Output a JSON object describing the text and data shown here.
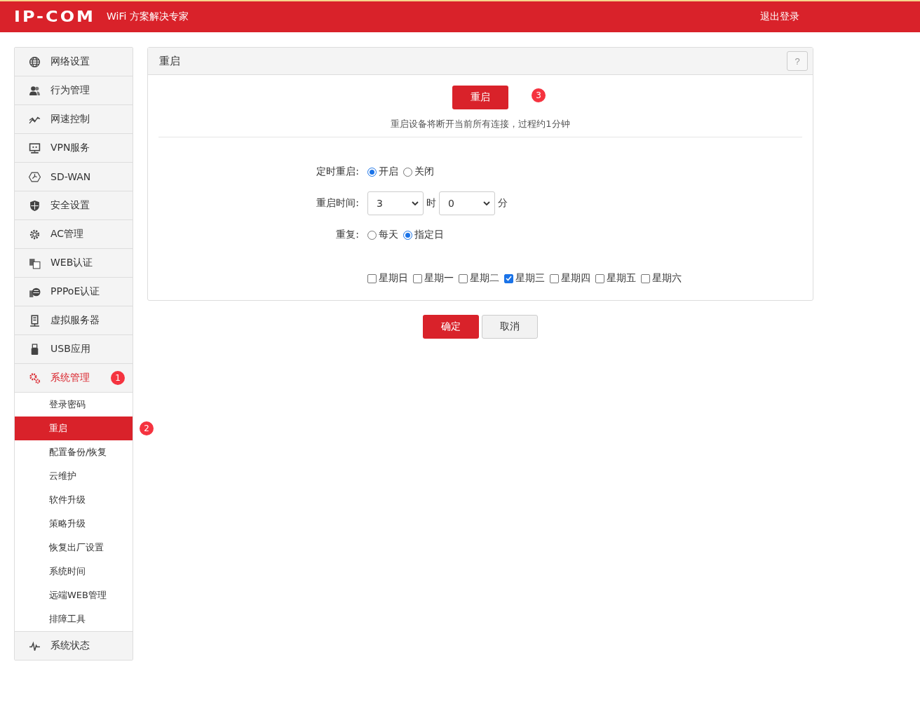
{
  "header": {
    "logo": "IP-COM",
    "tagline": "WiFi 方案解决专家",
    "logout": "退出登录"
  },
  "sidebar": {
    "items": [
      {
        "label": "网络设置",
        "expanded": false
      },
      {
        "label": "行为管理",
        "expanded": false
      },
      {
        "label": "网速控制",
        "expanded": false
      },
      {
        "label": "VPN服务",
        "expanded": false
      },
      {
        "label": "SD-WAN",
        "expanded": false
      },
      {
        "label": "安全设置",
        "expanded": false
      },
      {
        "label": "AC管理",
        "expanded": false
      },
      {
        "label": "WEB认证",
        "expanded": false
      },
      {
        "label": "PPPoE认证",
        "expanded": false
      },
      {
        "label": "虚拟服务器",
        "expanded": false
      },
      {
        "label": "USB应用",
        "expanded": false
      },
      {
        "label": "系统管理",
        "expanded": true,
        "badge": "1",
        "children": [
          {
            "label": "登录密码",
            "selected": false
          },
          {
            "label": "重启",
            "selected": true,
            "badge": "2"
          },
          {
            "label": "配置备份/恢复",
            "selected": false
          },
          {
            "label": "云维护",
            "selected": false
          },
          {
            "label": "软件升级",
            "selected": false
          },
          {
            "label": "策略升级",
            "selected": false
          },
          {
            "label": "恢复出厂设置",
            "selected": false
          },
          {
            "label": "系统时间",
            "selected": false
          },
          {
            "label": "远端WEB管理",
            "selected": false
          },
          {
            "label": "排障工具",
            "selected": false
          }
        ]
      },
      {
        "label": "系统状态",
        "expanded": false
      }
    ]
  },
  "panel": {
    "title": "重启",
    "help": "?",
    "reboot_button": "重启",
    "reboot_badge": "3",
    "note": "重启设备将断开当前所有连接，过程约1分钟",
    "schedule": {
      "label": "定时重启:",
      "options": [
        {
          "label": "开启",
          "selected": true
        },
        {
          "label": "关闭",
          "selected": false
        }
      ]
    },
    "time": {
      "label": "重启时间:",
      "hour": "3",
      "hour_unit": "时",
      "minute": "0",
      "minute_unit": "分"
    },
    "repeat": {
      "label": "重复:",
      "options": [
        {
          "label": "每天",
          "selected": false
        },
        {
          "label": "指定日",
          "selected": true
        }
      ]
    },
    "days": [
      {
        "label": "星期日",
        "checked": false
      },
      {
        "label": "星期一",
        "checked": false
      },
      {
        "label": "星期二",
        "checked": false
      },
      {
        "label": "星期三",
        "checked": true
      },
      {
        "label": "星期四",
        "checked": false
      },
      {
        "label": "星期五",
        "checked": false
      },
      {
        "label": "星期六",
        "checked": false
      }
    ]
  },
  "buttons": {
    "ok": "确定",
    "cancel": "取消"
  }
}
